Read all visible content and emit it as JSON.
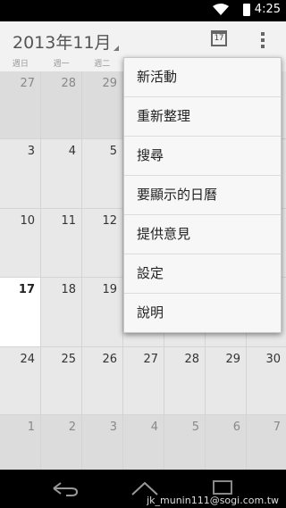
{
  "status_bar": {
    "time": "4:25",
    "wifi_icon": "wifi-icon",
    "battery_icon": "battery-icon"
  },
  "action_bar": {
    "title": "2013年11月",
    "today_icon_day": "17",
    "overflow_icon": "overflow-icon"
  },
  "weekdays": [
    "週日",
    "週一",
    "週二",
    "",
    "",
    "",
    ""
  ],
  "weeks": [
    [
      "27",
      "28",
      "29",
      "",
      "",
      "",
      ""
    ],
    [
      "3",
      "4",
      "5",
      "",
      "",
      "",
      ""
    ],
    [
      "10",
      "11",
      "12",
      "",
      "",
      "",
      ""
    ],
    [
      "17",
      "18",
      "19",
      "",
      "",
      "",
      ""
    ],
    [
      "24",
      "25",
      "26",
      "27",
      "28",
      "29",
      "30"
    ],
    [
      "1",
      "2",
      "3",
      "4",
      "5",
      "6",
      "7"
    ]
  ],
  "menu": {
    "items": [
      "新活動",
      "重新整理",
      "搜尋",
      "要顯示的日曆",
      "提供意見",
      "設定",
      "說明"
    ]
  },
  "nav_bar": {
    "footer_text": "jk_munin111@sogi.com.tw"
  }
}
